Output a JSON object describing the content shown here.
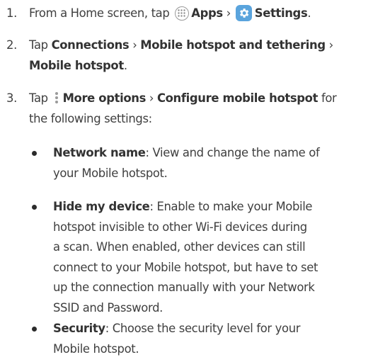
{
  "steps": [
    {
      "num": "1.",
      "parts": [
        "From a Home screen, tap",
        "Apps",
        "›",
        "Settings",
        "."
      ]
    },
    {
      "num": "2.",
      "parts": [
        "Tap",
        "Connections",
        "›",
        "Mobile hotspot and tethering",
        "›",
        "Mobile hotspot",
        "."
      ]
    },
    {
      "num": "3.",
      "parts": [
        "Tap",
        "More options",
        "›",
        "Configure mobile hotspot",
        "for",
        "the following settings:"
      ]
    }
  ],
  "bullets": [
    {
      "term": "Network name",
      "line1": ": View and change the name of",
      "line2": "your Mobile hotspot."
    },
    {
      "term": "Hide my device",
      "line1": ": Enable to make your Mobile",
      "lines": [
        "hotspot invisible to other Wi-Fi devices during",
        "a scan. When enabled, other devices can still",
        "connect to your Mobile hotspot, but have to set",
        "up the connection manually with your Network",
        "SSID and Password."
      ]
    },
    {
      "term": "Security",
      "line1": ": Choose the security level for your",
      "line2": "Mobile hotspot."
    }
  ],
  "icons": {
    "apps": "apps-grid-icon",
    "settings": "gear-icon",
    "more": "more-options-icon"
  },
  "colors": {
    "text": "#3f3f3f",
    "settings_icon_bg": "#5aa4dd"
  }
}
